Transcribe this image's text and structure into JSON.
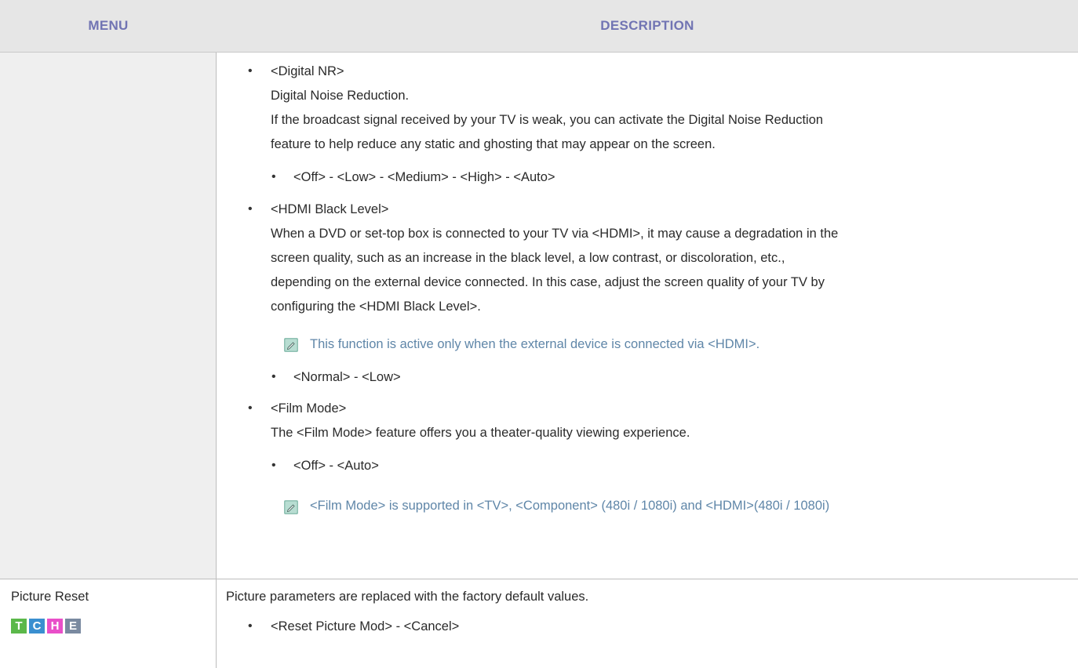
{
  "header": {
    "menu": "MENU",
    "description": "DESCRIPTION"
  },
  "digital_nr": {
    "title": "<Digital NR>",
    "subtitle": "Digital Noise Reduction.",
    "desc_line1": "If the broadcast signal received by your TV is weak, you can activate the Digital Noise Reduction",
    "desc_line2": "feature to help reduce any static and ghosting that may appear on the screen.",
    "options": "<Off> - <Low> - <Medium> - <High> - <Auto>"
  },
  "hdmi_black_level": {
    "title": "<HDMI Black Level>",
    "desc_line1": "When a DVD or set-top box is connected to your TV via <HDMI>, it may cause a degradation in the",
    "desc_line2": "screen quality, such as an increase in the black level, a low contrast, or discoloration, etc.,",
    "desc_line3": "depending on the external device connected. In this case, adjust the screen quality of your TV by",
    "desc_line4": "configuring the <HDMI Black Level>.",
    "note": "This function is active only when the external device is connected via <HDMI>.",
    "options": "<Normal> - <Low>"
  },
  "film_mode": {
    "title": "<Film Mode>",
    "desc": "The <Film Mode> feature offers you a theater-quality viewing experience.",
    "options": "<Off> - <Auto>",
    "note": "<Film Mode> is supported in <TV>, <Component> (480i / 1080i) and <HDMI>(480i / 1080i)"
  },
  "picture_reset": {
    "menu_label": "Picture Reset",
    "desc": "Picture parameters are replaced with the factory default values.",
    "options": "<Reset Picture Mod> - <Cancel>"
  },
  "badges": [
    {
      "letter": "T",
      "color": "#5bb84a"
    },
    {
      "letter": "C",
      "color": "#3a8fd0"
    },
    {
      "letter": "H",
      "color": "#e94fc9"
    },
    {
      "letter": "E",
      "color": "#7a8aa0"
    }
  ],
  "colors": {
    "header_text": "#7174b3",
    "note_text": "#5f86a8"
  }
}
